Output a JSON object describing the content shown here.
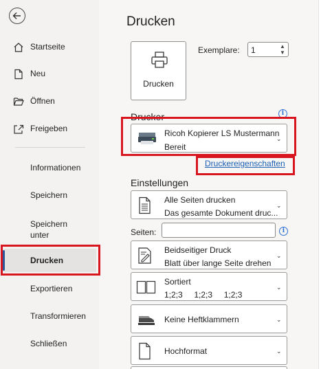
{
  "sidebar": {
    "back_icon": "back-arrow-icon",
    "items": [
      {
        "label": "Startseite",
        "icon": "home-icon"
      },
      {
        "label": "Neu",
        "icon": "new-document-icon"
      },
      {
        "label": "Öffnen",
        "icon": "folder-open-icon"
      },
      {
        "label": "Freigeben",
        "icon": "share-icon"
      },
      {
        "label": "Informationen"
      },
      {
        "label": "Speichern"
      },
      {
        "label": "Speichern unter"
      },
      {
        "label": "Drucken",
        "active": true
      },
      {
        "label": "Exportieren"
      },
      {
        "label": "Transformieren"
      },
      {
        "label": "Schließen"
      }
    ]
  },
  "main": {
    "title": "Drucken",
    "print_button_label": "Drucken",
    "copies_label": "Exemplare:",
    "copies_value": "1",
    "printer_section": "Drucker",
    "printer_name": "Ricoh Kopierer LS Mustermann",
    "printer_status": "Bereit",
    "printer_properties_link": "Druckereigenschaften",
    "settings_section": "Einstellungen",
    "pages_label": "Seiten:",
    "settings": [
      {
        "line1": "Alle Seiten drucken",
        "line2": "Das gesamte Dokument druc...",
        "icon": "document-pages-icon"
      },
      {
        "line1": "Beidseitiger Druck",
        "line2": "Blatt über lange Seite drehen",
        "icon": "duplex-print-icon"
      },
      {
        "line1": "Sortiert",
        "line2": "1;2;3     1;2;3     1;2;3",
        "icon": "collated-icon"
      },
      {
        "line1": "Keine Heftklammern",
        "icon": "stapler-icon"
      },
      {
        "line1": "Hochformat",
        "icon": "portrait-page-icon"
      }
    ]
  },
  "colors": {
    "highlight_border": "#d8141f",
    "accent": "#2b579a",
    "link": "#1a5fb4"
  }
}
